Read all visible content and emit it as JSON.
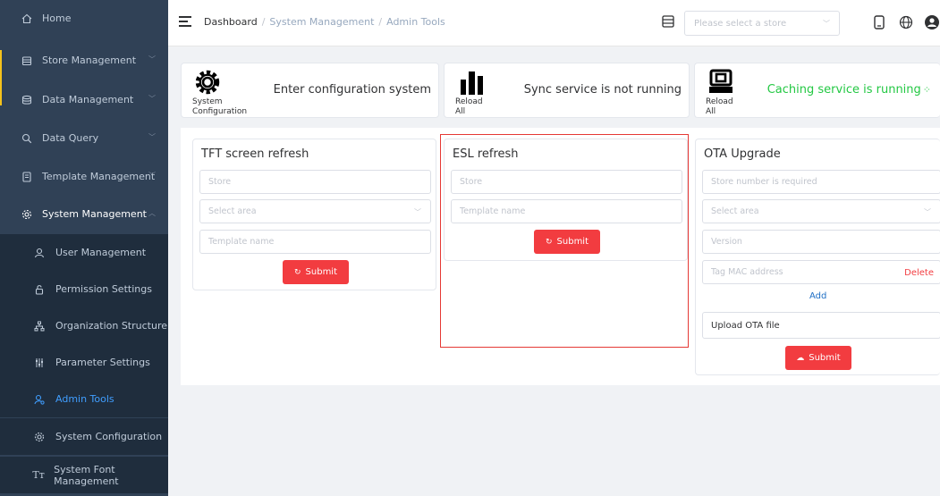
{
  "sidebar": {
    "items": [
      {
        "label": "Home",
        "icon": "home-icon"
      },
      {
        "label": "Store Management",
        "icon": "store-icon"
      },
      {
        "label": "Data Management",
        "icon": "database-icon"
      },
      {
        "label": "Data Query",
        "icon": "search-icon"
      },
      {
        "label": "Template Management",
        "icon": "template-icon"
      },
      {
        "label": "System Management",
        "icon": "gear-icon"
      }
    ],
    "sub_items": [
      {
        "label": "User Management",
        "icon": "user-icon"
      },
      {
        "label": "Permission Settings",
        "icon": "lock-icon"
      },
      {
        "label": "Organization Structure",
        "icon": "org-chart-icon"
      },
      {
        "label": "Parameter Settings",
        "icon": "sliders-icon"
      },
      {
        "label": "Admin Tools",
        "icon": "admin-tools-icon",
        "active": true
      },
      {
        "label": "System Configuration",
        "icon": "config-icon"
      },
      {
        "label": "System Font Management",
        "icon": "font-icon"
      }
    ]
  },
  "header": {
    "breadcrumb": [
      "Dashboard",
      "System Management",
      "Admin Tools"
    ],
    "store_placeholder": "Please select a store"
  },
  "top_cards": [
    {
      "caption": "System\nConfiguration",
      "message": "Enter configuration system",
      "icon": "gear-icon"
    },
    {
      "caption": "Reload\nAll",
      "message": "Sync service is not running",
      "icon": "bar-chart-icon"
    },
    {
      "caption": "Reload\nAll",
      "message": "Caching service is running",
      "icon": "server-icon"
    }
  ],
  "tft": {
    "title": "TFT screen refresh",
    "store_placeholder": "Store",
    "area_placeholder": "Select area",
    "template_placeholder": "Template name",
    "submit_label": "Submit"
  },
  "esl": {
    "title": "ESL refresh",
    "store_placeholder": "Store",
    "template_placeholder": "Template name",
    "submit_label": "Submit"
  },
  "ota": {
    "title": "OTA Upgrade",
    "store_placeholder": "Store number is required",
    "area_placeholder": "Select area",
    "version_placeholder": "Version",
    "mac_placeholder": "Tag MAC address",
    "delete_label": "Delete",
    "add_label": "Add",
    "upload_label": "Upload OTA file",
    "submit_label": "Submit"
  },
  "colors": {
    "sidebar_bg": "#304156",
    "submenu_bg": "#1f2d3d",
    "active": "#409eff",
    "accent": "#f23c40",
    "running": "#23c843",
    "highlight_box": "#e53935"
  }
}
